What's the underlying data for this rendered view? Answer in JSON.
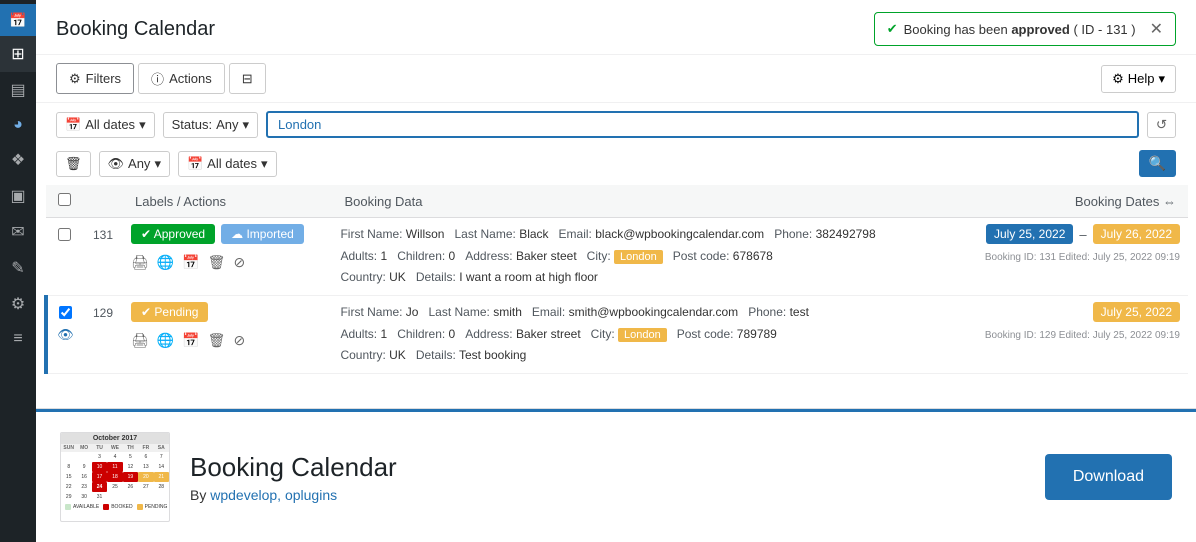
{
  "app": {
    "title": "Booking Calendar",
    "subtitle": "By",
    "subtitle_link": "wpdevelop, oplugins"
  },
  "notification": {
    "text_prefix": "Booking has been",
    "status": "approved",
    "id_text": "( ID - 131 )"
  },
  "toolbar": {
    "filters_label": "Filters",
    "actions_label": "Actions",
    "help_label": "Help"
  },
  "filters": {
    "all_dates_label": "All dates",
    "status_label": "Status:",
    "status_value": "Any",
    "search_value": "London",
    "any_label": "Any",
    "all_dates2_label": "All dates"
  },
  "table": {
    "col_labels_actions": "Labels / Actions",
    "col_booking_data": "Booking Data",
    "col_booking_dates": "Booking Dates"
  },
  "bookings": [
    {
      "id": 131,
      "status": "Approved",
      "status_class": "approved",
      "import_label": "Imported",
      "first_name": "Willson",
      "last_name": "Black",
      "email": "black@wpbookingcalendar.com",
      "phone": "382492798",
      "adults": "1",
      "children": "0",
      "address": "Baker steet",
      "city": "London",
      "postcode": "678678",
      "country": "UK",
      "details": "I want a room at high floor",
      "date_start": "July 25, 2022",
      "date_end": "July 26, 2022",
      "meta": "Booking ID: 131  Edited: July 25, 2022 09:19",
      "has_eye": false,
      "checked": false
    },
    {
      "id": 129,
      "status": "Pending",
      "status_class": "pending",
      "import_label": null,
      "first_name": "Jo",
      "last_name": "smith",
      "email": "smith@wpbookingcalendar.com",
      "phone": "test",
      "adults": "1",
      "children": "0",
      "address": "Baker street",
      "city": "London",
      "postcode": "789789",
      "country": "UK",
      "details": "Test booking",
      "date_start": "July 25, 2022",
      "date_end": null,
      "meta": "Booking ID: 129  Edited: July 25, 2022 09:19",
      "has_eye": true,
      "checked": true
    }
  ],
  "download": {
    "label": "Download"
  },
  "sidebar": {
    "icons": [
      "☰",
      "◉",
      "✦",
      "❖",
      "▣",
      "⚑",
      "✎",
      "⚙",
      "≡"
    ]
  }
}
